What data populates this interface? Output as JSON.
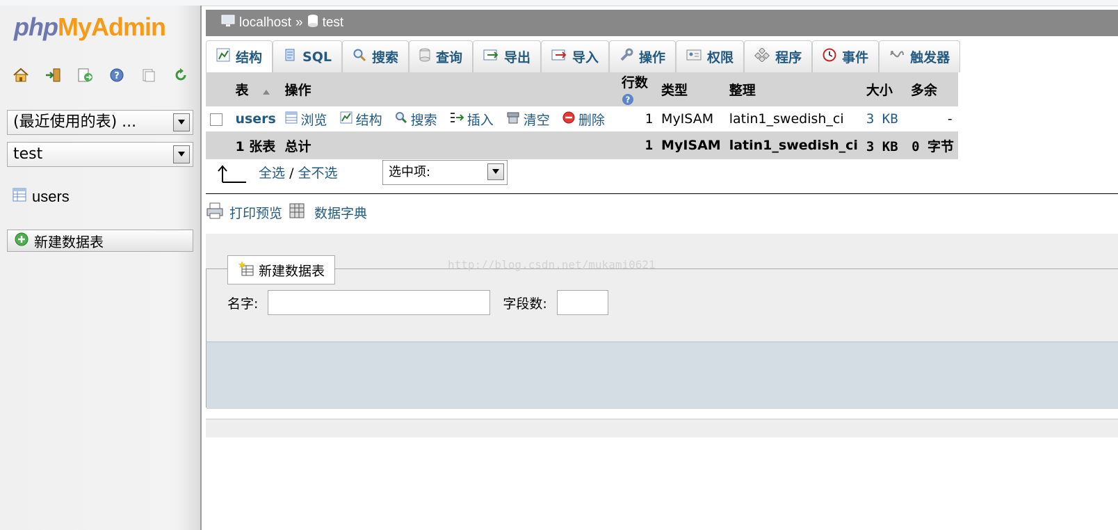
{
  "app": {
    "logo_php": "php",
    "logo_myadmin": "MyAdmin"
  },
  "sidebar": {
    "nav_icons": [
      "home-icon",
      "logout-icon",
      "query-window-icon",
      "help-icon",
      "documentation-icon",
      "reload-icon"
    ],
    "recent_tables": "(最近使用的表) ...",
    "database_select": "test",
    "tables": [
      {
        "name": "users"
      }
    ],
    "new_table": "新建数据表"
  },
  "breadcrumb": {
    "server": "localhost",
    "separator": "»",
    "database": "test"
  },
  "tabs": [
    {
      "label": "结构",
      "icon": "structure-icon",
      "active": true
    },
    {
      "label": "SQL",
      "icon": "sql-icon"
    },
    {
      "label": "搜索",
      "icon": "search-icon"
    },
    {
      "label": "查询",
      "icon": "query-icon"
    },
    {
      "label": "导出",
      "icon": "export-icon"
    },
    {
      "label": "导入",
      "icon": "import-icon"
    },
    {
      "label": "操作",
      "icon": "wrench-icon"
    },
    {
      "label": "权限",
      "icon": "privileges-icon"
    },
    {
      "label": "程序",
      "icon": "routines-icon"
    },
    {
      "label": "事件",
      "icon": "events-icon"
    },
    {
      "label": "触发器",
      "icon": "triggers-icon"
    }
  ],
  "table": {
    "headers": {
      "table": "表",
      "action": "操作",
      "rows": "行数",
      "type": "类型",
      "collation": "整理",
      "size": "大小",
      "overhead": "多余"
    },
    "rows": [
      {
        "name": "users",
        "actions": [
          "浏览",
          "结构",
          "搜索",
          "插入",
          "清空",
          "删除"
        ],
        "rows": "1",
        "type": "MyISAM",
        "collation": "latin1_swedish_ci",
        "size": "3 KB",
        "overhead": "-"
      }
    ],
    "footer": {
      "count": "1 张表",
      "label": "总计",
      "rows": "1",
      "type": "MyISAM",
      "collation": "latin1_swedish_ci",
      "size": "3 KB",
      "overhead": "0 字节"
    }
  },
  "selection": {
    "check_all": "全选",
    "separator": "/",
    "uncheck_all": "全不选",
    "with_selected": "选中项:"
  },
  "extras": {
    "print_view": "打印预览",
    "data_dictionary": "数据字典"
  },
  "create_table": {
    "legend": "新建数据表",
    "name_label": "名字:",
    "fields_label": "字段数:",
    "name_value": "",
    "fields_value": ""
  },
  "watermark": "http://blog.csdn.net/mukami0621"
}
